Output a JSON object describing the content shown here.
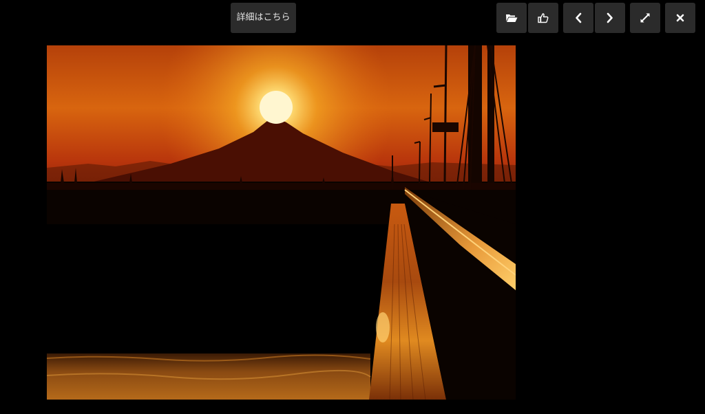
{
  "toolbar": {
    "details_label": "詳細はこちら",
    "buttons": [
      {
        "name": "folder-open-button",
        "icon": "folder-open-icon"
      },
      {
        "name": "like-button",
        "icon": "thumbs-up-icon"
      },
      {
        "name": "previous-button",
        "icon": "chevron-left-icon"
      },
      {
        "name": "next-button",
        "icon": "chevron-right-icon"
      },
      {
        "name": "fullscreen-button",
        "icon": "expand-icon"
      },
      {
        "name": "close-button",
        "icon": "close-icon"
      }
    ]
  },
  "photo": {
    "subject": "sunset-over-mountain-from-bridge"
  },
  "colors": {
    "background": "#000000",
    "button_bg": "#2b2b2b",
    "button_icon": "#ffffff",
    "sky_top": "#b5410a",
    "sun": "#fff3b0"
  }
}
